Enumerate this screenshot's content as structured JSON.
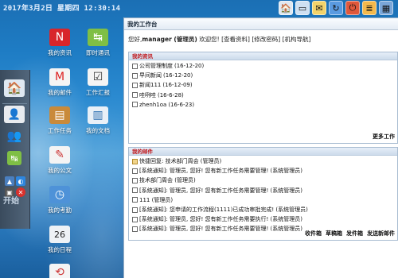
{
  "clock": "2017年3月2日 星期四 12:30:14",
  "toolbar": [
    {
      "name": "home-icon",
      "glyph": "🏠",
      "bg": "#dfe8f1"
    },
    {
      "name": "desktop-icon",
      "glyph": "▭",
      "bg": "#cfe0f2"
    },
    {
      "name": "mail-icon",
      "glyph": "✉",
      "bg": "#f3d36a"
    },
    {
      "name": "refresh-icon",
      "glyph": "↻",
      "bg": "#5a9ae0"
    },
    {
      "name": "logout-icon",
      "glyph": "⏻",
      "bg": "#e0583c"
    },
    {
      "name": "notes-icon",
      "glyph": "≣",
      "bg": "#f4b94c"
    },
    {
      "name": "calendar-icon",
      "glyph": "▦",
      "bg": "#7aa6d8"
    }
  ],
  "dock": {
    "label": "开始"
  },
  "desktop_icons": [
    {
      "label": "我的资讯",
      "glyph": "N",
      "bg": "#d8262b",
      "fg": "#fff"
    },
    {
      "label": "即时通讯",
      "glyph": "↹",
      "bg": "#7fbf45",
      "fg": "#fff"
    },
    {
      "label": "我的邮件",
      "glyph": "M",
      "bg": "#f4f4f4",
      "fg": "#d22"
    },
    {
      "label": "工作汇报",
      "glyph": "☑",
      "bg": "#f4f4f4",
      "fg": "#333"
    },
    {
      "label": "工作任务",
      "glyph": "▤",
      "bg": "#c98a3a",
      "fg": "#fff"
    },
    {
      "label": "我的文档",
      "glyph": "▥",
      "bg": "#e9f0f7",
      "fg": "#2a6db0"
    },
    {
      "label": "我的公文",
      "glyph": "✎",
      "bg": "#f4f4f4",
      "fg": "#c33"
    },
    {
      "label": "我的考勤",
      "glyph": "◷",
      "bg": "#4e92d8",
      "fg": "#fff"
    },
    {
      "label": "我的日程",
      "glyph": "26",
      "bg": "#eef2f6",
      "fg": "#222"
    },
    {
      "label": "",
      "glyph": "⟲",
      "bg": "#f4f4f4",
      "fg": "#c33"
    }
  ],
  "workspace": {
    "title": "我的工作台",
    "greeting_prefix": "您好,",
    "user": "manager (管理员)",
    "greeting_suffix": "欢迎您!",
    "links": "[查看资料] [修改密码] [机构导航]"
  },
  "news": {
    "header": "我的资讯",
    "items": [
      {
        "title": "公司管理制度",
        "date": "(16-12-20)"
      },
      {
        "title": "早间新闻",
        "date": "(16-12-20)"
      },
      {
        "title": "新闻111",
        "date": "(16-12-09)"
      },
      {
        "title": "哇咧哇",
        "date": "(16-6-28)"
      },
      {
        "title": "zhenh1oa",
        "date": "(16-6-23)"
      }
    ],
    "more": "更多工作"
  },
  "mail": {
    "header": "我的邮件",
    "items": [
      {
        "text": "快捷回复: 技术部门周会 (管理员)",
        "icon": "env"
      },
      {
        "text": "[系统通知]: 管理员, 您好! 您有新工作任务需要管理! (系统管理员)",
        "icon": "box"
      },
      {
        "text": "技术部门周会 (管理员)",
        "icon": "box"
      },
      {
        "text": "[系统通知]: 管理员, 您好! 您有新工作任务需要管理! (系统管理员)",
        "icon": "box"
      },
      {
        "text": "111 (管理员)",
        "icon": "box"
      },
      {
        "text": "[系统通知]: 您申请的工作流程(1111)已成功审批完成! (系统管理员)",
        "icon": "box"
      },
      {
        "text": "[系统通知]: 管理员, 您好! 您有新工作任务需要执行! (系统管理员)",
        "icon": "box"
      },
      {
        "text": "[系统通知]: 管理员, 您好! 您有新工作任务需要管理! (系统管理员)",
        "icon": "box"
      }
    ],
    "links": [
      "收件箱",
      "草稿箱",
      "发件箱",
      "发送新邮件"
    ]
  }
}
